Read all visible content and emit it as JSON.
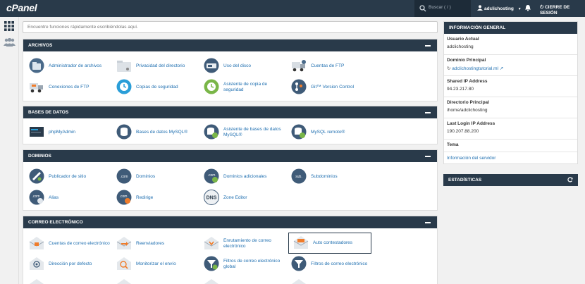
{
  "topbar": {
    "logo": "cPanel",
    "search_placeholder": "Buscar ( / )",
    "username": "adclichosting",
    "logout": "CIERRE DE SESIÓN"
  },
  "search": {
    "placeholder": "Encuentre funciones rápidamente escribiéndolas aquí."
  },
  "sections": {
    "archivos": {
      "title": "ARCHIVOS",
      "items": [
        {
          "label": "Administrador de archivos",
          "icon": "file-manager-icon"
        },
        {
          "label": "Privacidad del directorio",
          "icon": "folder-privacy-icon"
        },
        {
          "label": "Uso del disco",
          "icon": "disk-usage-icon"
        },
        {
          "label": "Cuentas de FTP",
          "icon": "ftp-accounts-icon"
        },
        {
          "label": "Conexiones de FTP",
          "icon": "ftp-connections-icon"
        },
        {
          "label": "Copias de seguridad",
          "icon": "backup-icon"
        },
        {
          "label": "Asistente de copia de seguridad",
          "icon": "backup-wizard-icon"
        },
        {
          "label": "Git™ Version Control",
          "icon": "git-icon"
        }
      ]
    },
    "bases": {
      "title": "BASES DE DATOS",
      "items": [
        {
          "label": "phpMyAdmin",
          "icon": "phpmyadmin-icon"
        },
        {
          "label": "Bases de datos MySQL®",
          "icon": "mysql-databases-icon"
        },
        {
          "label": "Asistente de bases de datos MySQL®",
          "icon": "mysql-wizard-icon"
        },
        {
          "label": "MySQL remoto®",
          "icon": "remote-mysql-icon"
        }
      ]
    },
    "dominios": {
      "title": "DOMINIOS",
      "items": [
        {
          "label": "Publicador de sitio",
          "icon": "site-publisher-icon"
        },
        {
          "label": "Dominios",
          "icon": "domains-icon"
        },
        {
          "label": "Dominios adicionales",
          "icon": "addon-domains-icon"
        },
        {
          "label": "Subdominios",
          "icon": "subdomains-icon"
        },
        {
          "label": "Alias",
          "icon": "aliases-icon"
        },
        {
          "label": "Redirige",
          "icon": "redirects-icon"
        },
        {
          "label": "Zone Editor",
          "icon": "zone-editor-icon"
        }
      ]
    },
    "correo": {
      "title": "CORREO ELECTRÓNICO",
      "items": [
        {
          "label": "Cuentas de correo electrónico",
          "icon": "email-accounts-icon"
        },
        {
          "label": "Reenviadores",
          "icon": "forwarders-icon"
        },
        {
          "label": "Enrutamiento de correo electrónico",
          "icon": "email-routing-icon"
        },
        {
          "label": "Auto contestadores",
          "icon": "autoresponders-icon"
        },
        {
          "label": "Dirección por defecto",
          "icon": "default-address-icon"
        },
        {
          "label": "Monitorizar el envío",
          "icon": "track-delivery-icon"
        },
        {
          "label": "Filtros de correo electrónico global",
          "icon": "global-filters-icon"
        },
        {
          "label": "Filtros de correo electrónico",
          "icon": "email-filters-icon"
        }
      ]
    }
  },
  "info": {
    "title": "INFORMACIÓN GENERAL",
    "user_label": "Usuario Actual",
    "user_value": "adclichosting",
    "domain_label": "Dominio Principal",
    "domain_value": "adclichostingtutorial.ml",
    "shared_ip_label": "Shared IP Address",
    "shared_ip_value": "94.23.217.80",
    "homedir_label": "Directorio Principal",
    "homedir_value": "/home/adclichosting",
    "last_ip_label": "Last Login IP Address",
    "last_ip_value": "190.207.88.200",
    "theme_label": "Tema",
    "server_info": "Información del servidor"
  },
  "stats": {
    "title": "ESTADÍSTICAS"
  },
  "colors": {
    "header": "#293a4a",
    "link": "#1f6fb0",
    "accent": "#f07c2a"
  }
}
